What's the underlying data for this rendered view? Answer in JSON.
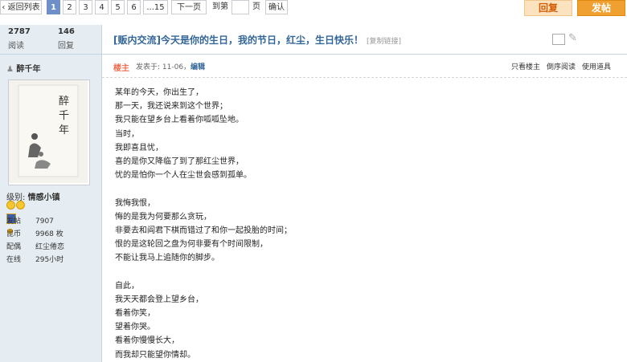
{
  "pagination": {
    "back_label": "返回列表",
    "pages": [
      "1",
      "2",
      "3",
      "4",
      "5",
      "6",
      "...15"
    ],
    "current": "1",
    "next_label": "下一页",
    "goto_prefix": "到第",
    "goto_suffix": "页",
    "confirm_label": "确认"
  },
  "actions": {
    "reply_label": "回复",
    "post_label": "发帖"
  },
  "stats": {
    "views": "2787",
    "views_label": "阅读",
    "replies": "146",
    "replies_label": "回复"
  },
  "author": {
    "name": "醉千年",
    "level_label": "级别:",
    "level": "情感小镇",
    "profile": [
      {
        "key": "发帖",
        "value": "7907"
      },
      {
        "key": "昆币",
        "value": "9968 枚"
      },
      {
        "key": "配偶",
        "value": "红尘倦恋"
      },
      {
        "key": "在线",
        "value": "295小时"
      }
    ]
  },
  "thread": {
    "title": "[贩内交流]今天是你的生日，我的节日，红尘，生日快乐！",
    "copy_link": "[复制链接]"
  },
  "post": {
    "owner_tag": "楼主",
    "time_prefix": "发表于: 11-06，",
    "edit_label": "编辑",
    "tools": [
      "只看楼主",
      "倒序阅读",
      "使用道具"
    ],
    "lines": [
      "某年的今天，你出生了，",
      "那一天，我还说来到这个世界；",
      "我只能在望乡台上看着你呱呱坠地。",
      "当时，",
      "我即喜且忧，",
      "喜的是你又降临了到了那红尘世界，",
      "忧的是怕你一个人在尘世会感到孤单。",
      "",
      "我悔我恨，",
      "悔的是我为何要那么贪玩，",
      "非要去和阎君下棋而错过了和你一起投胎的时间；",
      "恨的是这轮回之盘为何非要有个时间限制，",
      "不能让我马上追随你的脚步。",
      "",
      "自此，",
      "我天天都会登上望乡台，",
      "看着你笑，",
      "望着你哭。",
      "看着你慢慢长大，",
      "而我却只能望你情却。"
    ]
  },
  "colors": {
    "accent": "#336699",
    "current_page": "#6e8fc9",
    "post_button": "#f0a030",
    "sidebar": "#e5edf2"
  }
}
